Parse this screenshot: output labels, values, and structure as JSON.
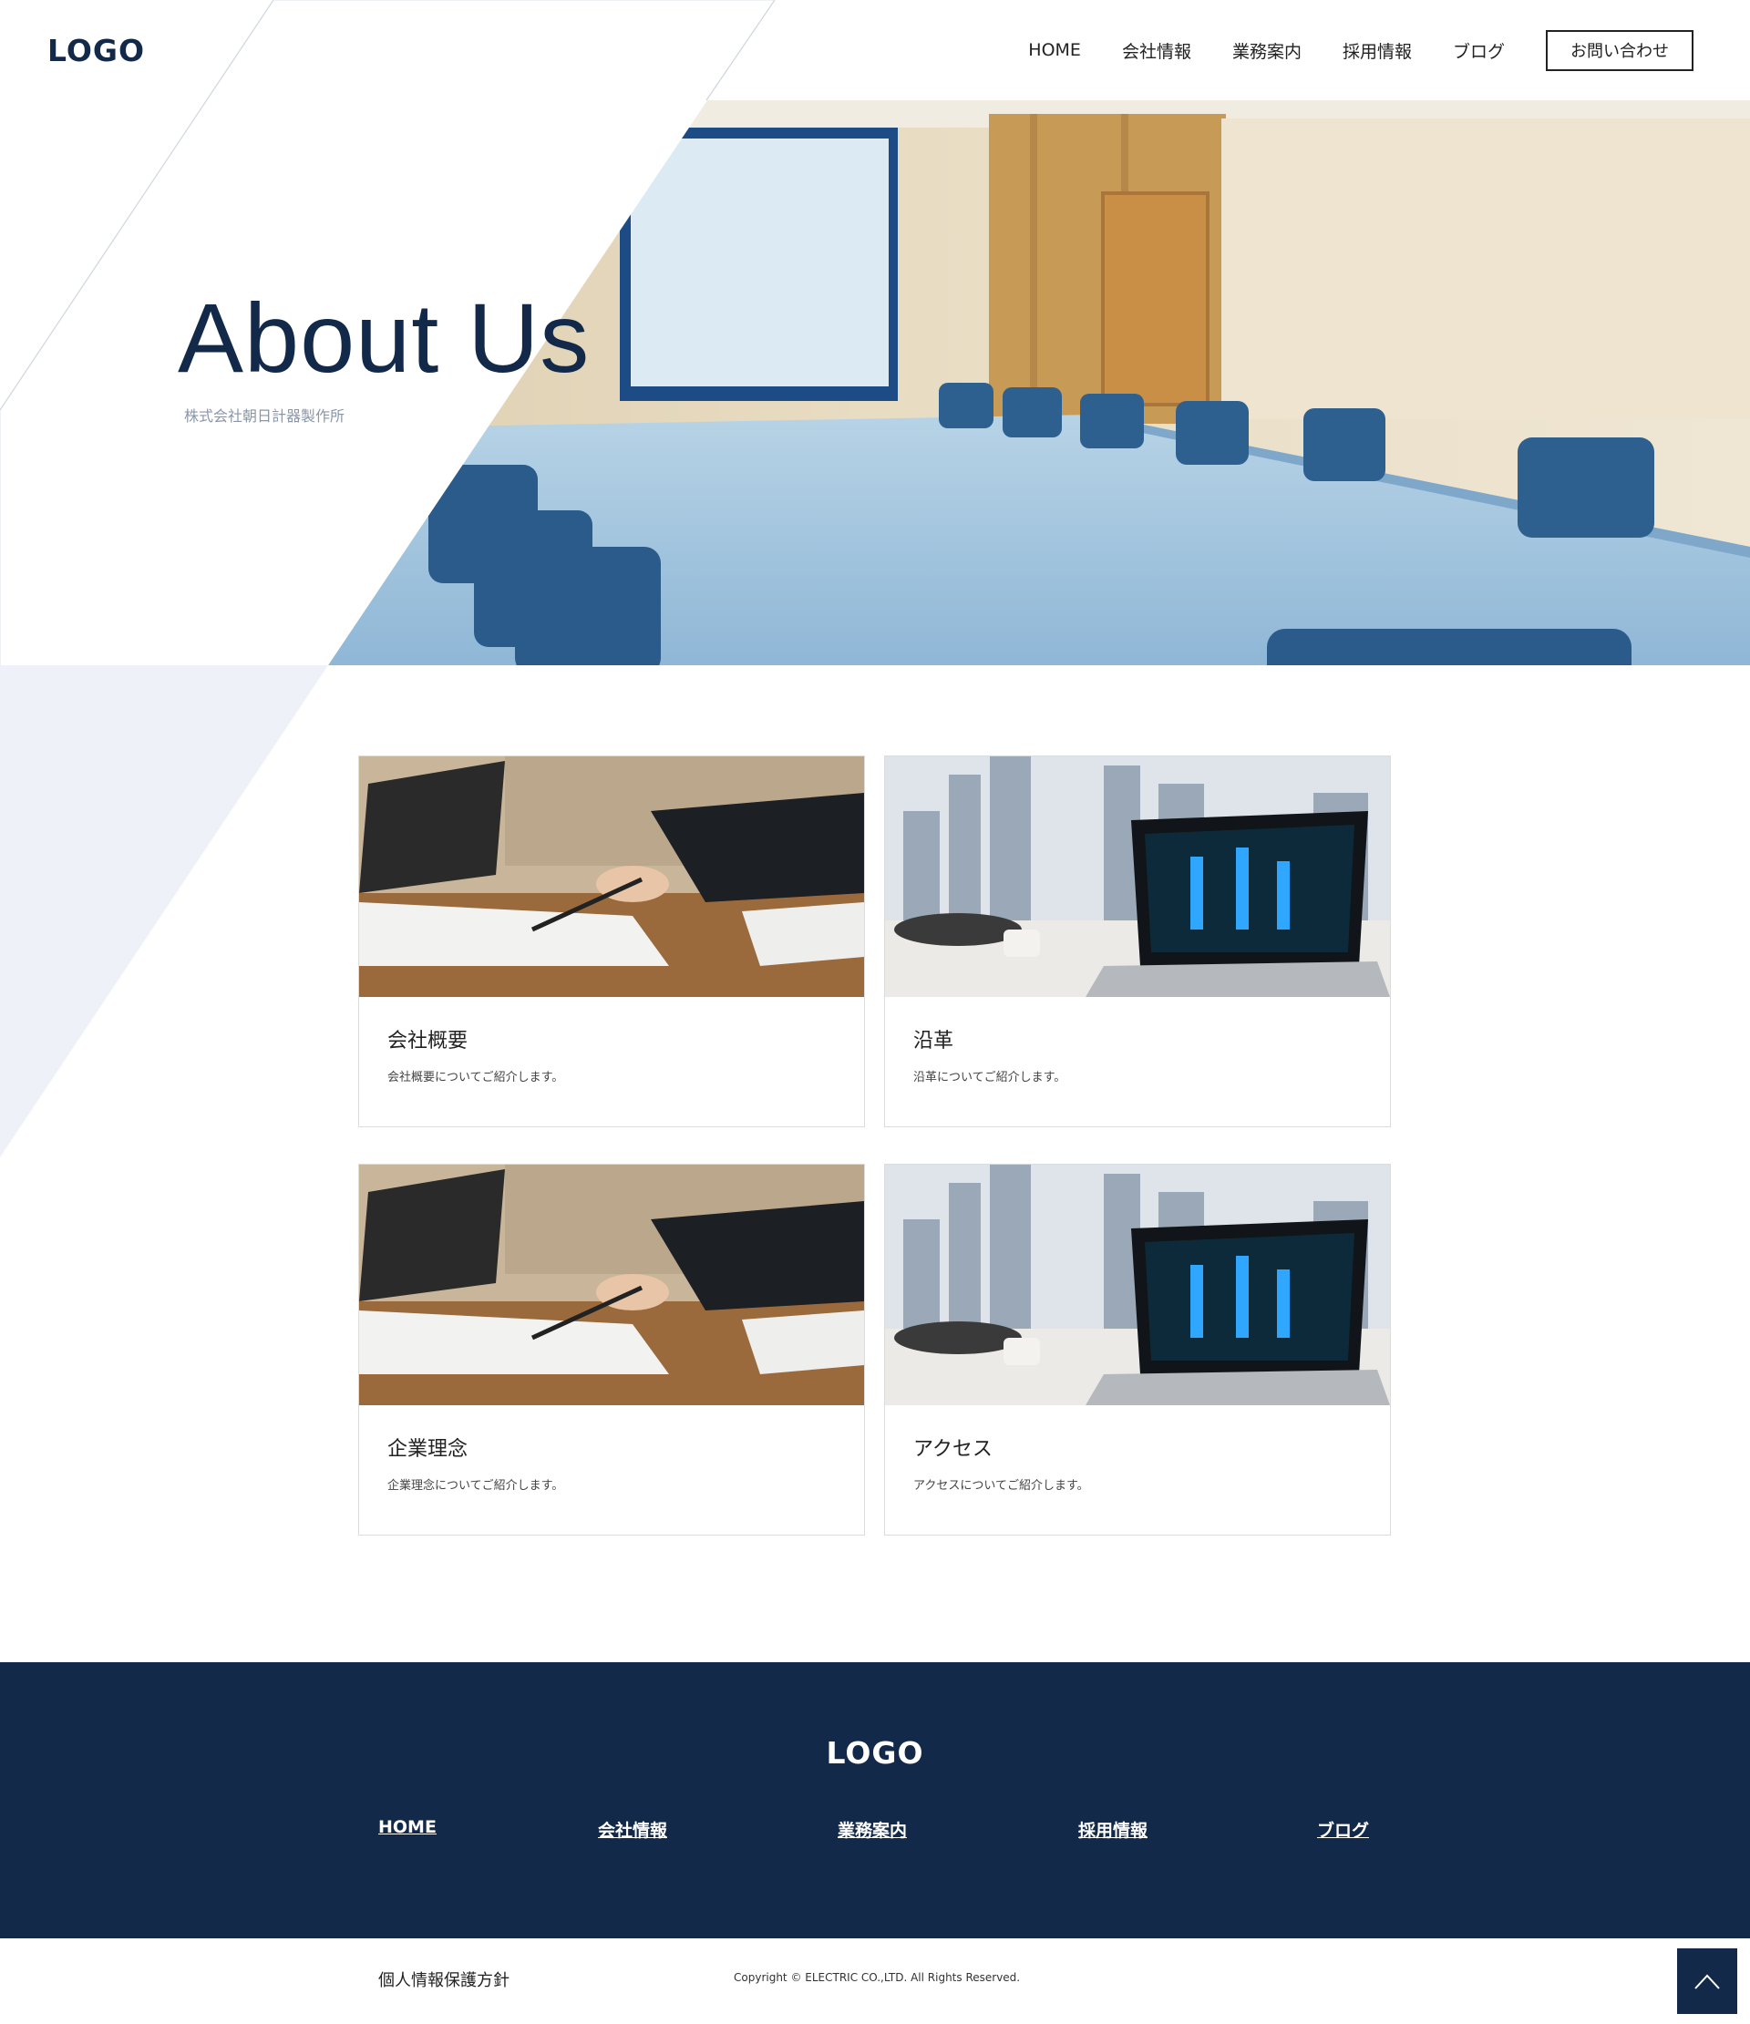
{
  "header": {
    "logo": "LOGO",
    "nav": [
      "HOME",
      "会社情報",
      "業務案内",
      "採用情報",
      "ブログ"
    ],
    "contact_label": "お問い合わせ"
  },
  "hero": {
    "title": "About Us",
    "subtitle": "株式会社朝日計器製作所"
  },
  "cards": [
    {
      "title": "会社概要",
      "desc": "会社概要についてご紹介します。",
      "image": "business-meeting-photo"
    },
    {
      "title": "沿革",
      "desc": "沿革についてご紹介します。",
      "image": "laptop-city-photo"
    },
    {
      "title": "企業理念",
      "desc": "企業理念についてご紹介します。",
      "image": "business-meeting-photo"
    },
    {
      "title": "アクセス",
      "desc": "アクセスについてご紹介します。",
      "image": "laptop-city-photo"
    }
  ],
  "footer": {
    "logo": "LOGO",
    "nav": [
      "HOME",
      "会社情報",
      "業務案内",
      "採用情報",
      "ブログ"
    ],
    "privacy": "個人情報保護方針",
    "copyright": "Copyright © ELECTRIC CO.,LTD. All Rights Reserved."
  },
  "colors": {
    "navy": "#13294a",
    "muted_text": "#8a96a8",
    "light_deco": "#eef2f8"
  },
  "icons": {
    "to_top": "chevron-up-icon"
  }
}
